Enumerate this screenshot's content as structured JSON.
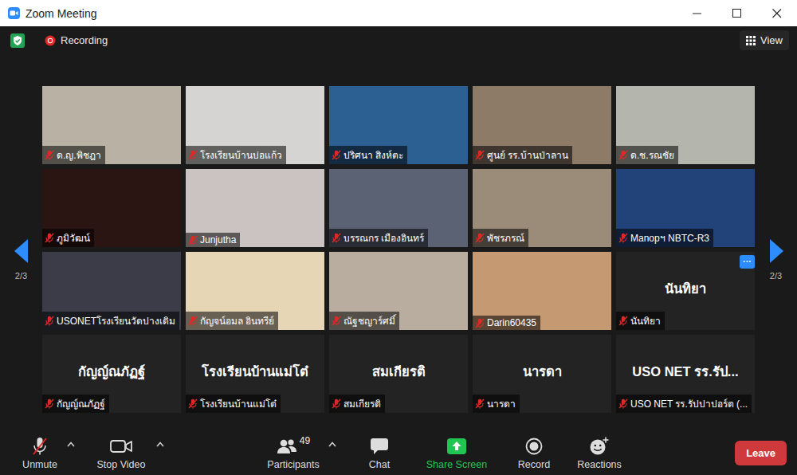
{
  "window": {
    "title": "Zoom Meeting"
  },
  "top_bar": {
    "recording_label": "Recording",
    "view_label": "View"
  },
  "gallery": {
    "page_left": "2/3",
    "page_right": "2/3",
    "tiles": [
      {
        "name": "ด.ญ.พิชฎา",
        "kind": "video",
        "muted": true,
        "color": "#b9b1a3"
      },
      {
        "name": "โรงเรียนบ้านบ่อแก้ว",
        "kind": "video",
        "muted": true,
        "color": "#d6d4d2"
      },
      {
        "name": "ปริศนา สิงห์ตะ",
        "kind": "video",
        "muted": true,
        "color": "#2c5f92"
      },
      {
        "name": "ศูนย์ รร.บ้านป่าลาน",
        "kind": "video",
        "muted": true,
        "color": "#8d7b68"
      },
      {
        "name": "ด.ช.รณชัย",
        "kind": "video",
        "muted": true,
        "color": "#b4b6ae"
      },
      {
        "name": "ภูมิวัฒน์",
        "kind": "video",
        "muted": true,
        "color": "#2a1513"
      },
      {
        "name": "Junjutha",
        "kind": "video",
        "muted": true,
        "color": "#cbc3c2"
      },
      {
        "name": "บรรณกร  เมืองอินทร์",
        "kind": "video",
        "muted": true,
        "color": "#5b6273"
      },
      {
        "name": "พัชรภรณ์",
        "kind": "video",
        "muted": true,
        "color": "#9b8c7a"
      },
      {
        "name": "Manopฯ NBTC-R3",
        "kind": "video",
        "muted": true,
        "color": "#22427a"
      },
      {
        "name": "USONETโรงเรียนวัดปางเดิม",
        "kind": "video",
        "muted": true,
        "color": "#3b3c47"
      },
      {
        "name": "กัญจน์อมล อินทรีย์",
        "kind": "video",
        "muted": true,
        "color": "#e6d6b6"
      },
      {
        "name": "ณัฐชญาร์ศมิ์",
        "kind": "video",
        "muted": true,
        "color": "#b9ada0"
      },
      {
        "name": "Darin60435",
        "kind": "video",
        "muted": true,
        "color": "#c59a72"
      },
      {
        "name": "นันทิยา",
        "kind": "name",
        "muted": true,
        "display": "นันทิยา",
        "menu": "···"
      },
      {
        "name": "กัญญ์ณภัฏฐ์",
        "kind": "name",
        "muted": true,
        "display": "กัญญ์ณภัฏฐ์"
      },
      {
        "name": "โรงเรียนบ้านแม่โต๋",
        "kind": "name",
        "muted": true,
        "display": "โรงเรียนบ้านแม่โต๋"
      },
      {
        "name": "สมเกียรติ",
        "kind": "name",
        "muted": true,
        "display": "สมเกียรติ"
      },
      {
        "name": "นารดา",
        "kind": "name",
        "muted": true,
        "display": "นารดา"
      },
      {
        "name": "USO NET รร.รัปปาปอร์ต (...",
        "kind": "name",
        "muted": true,
        "display": "USO NET รร.รัป..."
      }
    ]
  },
  "toolbar": {
    "buttons": [
      {
        "label": "Unmute",
        "kind": "mic",
        "has_menu": true
      },
      {
        "label": "Stop Video",
        "kind": "video",
        "has_menu": true
      },
      {
        "label": "Participants",
        "kind": "participants",
        "has_menu": true,
        "badge": "49"
      },
      {
        "label": "Chat",
        "kind": "chat",
        "has_menu": false
      },
      {
        "label": "Share Screen",
        "kind": "share",
        "has_menu": false
      },
      {
        "label": "Record",
        "kind": "record",
        "has_menu": false
      },
      {
        "label": "Reactions",
        "kind": "reactions",
        "has_menu": false
      }
    ],
    "leave": "Leave"
  }
}
